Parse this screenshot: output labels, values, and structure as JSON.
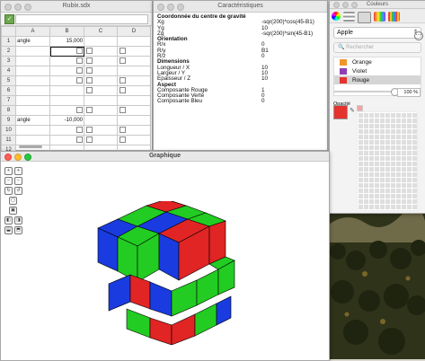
{
  "desktop": {
    "wallpaper": "vineyard-hills"
  },
  "spreadsheet": {
    "title": "Rubix.sdx",
    "columns": [
      "A",
      "B",
      "C",
      "D"
    ],
    "rows": [
      {
        "n": "1",
        "a": "angle",
        "b": "15,000"
      },
      {
        "n": "2"
      },
      {
        "n": "3"
      },
      {
        "n": "4"
      },
      {
        "n": "5"
      },
      {
        "n": "6"
      },
      {
        "n": "7"
      },
      {
        "n": "8"
      },
      {
        "n": "9",
        "a": "angle",
        "b": "-10,000"
      },
      {
        "n": "10"
      },
      {
        "n": "11"
      },
      {
        "n": "12"
      }
    ]
  },
  "properties": {
    "title": "Caractéristiques",
    "rows": [
      {
        "k": "Coordonnée du centre de gravité",
        "v": "",
        "h": true
      },
      {
        "k": "Xg",
        "v": "-sqr(200)*cos(45-B1)"
      },
      {
        "k": "Yg",
        "v": "10"
      },
      {
        "k": "Zg",
        "v": "-sqr(200)*sin(45-B1)"
      },
      {
        "k": "Orientation",
        "v": "",
        "h": true
      },
      {
        "k": "R/x",
        "v": "0"
      },
      {
        "k": "R/y",
        "v": "B1"
      },
      {
        "k": "R/z",
        "v": "0"
      },
      {
        "k": "Dimensions",
        "v": "",
        "h": true
      },
      {
        "k": "Longueur / X",
        "v": "10"
      },
      {
        "k": "Largeur / Y",
        "v": "10"
      },
      {
        "k": "Epaisseur / Z",
        "v": "10"
      },
      {
        "k": "Aspect",
        "v": "",
        "h": true
      },
      {
        "k": "Composante Rouge",
        "v": "1"
      },
      {
        "k": "Composante Verte",
        "v": "0"
      },
      {
        "k": "Composante Bleu",
        "v": "0"
      }
    ]
  },
  "colors": {
    "title": "Couleurs",
    "palette": "Apple",
    "search_placeholder": "Rechercher",
    "items": [
      {
        "label": "Orange",
        "color": "#f0952a"
      },
      {
        "label": "Violet",
        "color": "#8e3fb5"
      },
      {
        "label": "Rouge",
        "color": "#e5322d"
      }
    ],
    "opacity_label": "Opacité",
    "opacity_value": "100 %",
    "current_color": "#e5322d"
  },
  "graphics": {
    "title": "Graphique"
  }
}
